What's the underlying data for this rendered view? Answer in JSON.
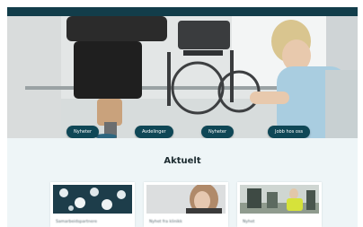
{
  "hero": {
    "buttons": [
      {
        "label": "Nyheter",
        "icon": "button-pill"
      },
      {
        "label": "Avdelinger",
        "icon": "button-pill"
      },
      {
        "label": "Nyheter",
        "icon": "button-pill"
      },
      {
        "label": "Jobb hos oss",
        "icon": "button-pill"
      }
    ]
  },
  "news": {
    "heading": "Aktuelt",
    "cards": [
      {
        "title": "Samarbeidspartnere",
        "image": "dots-graphic"
      },
      {
        "title": "Nyhet fra klinikk",
        "image": "woman-portrait"
      },
      {
        "title": "Nyhet",
        "image": "training-room"
      }
    ]
  },
  "colors": {
    "brand_dark": "#123d4a",
    "button": "#0f4756",
    "section_bg": "#eef5f7"
  }
}
